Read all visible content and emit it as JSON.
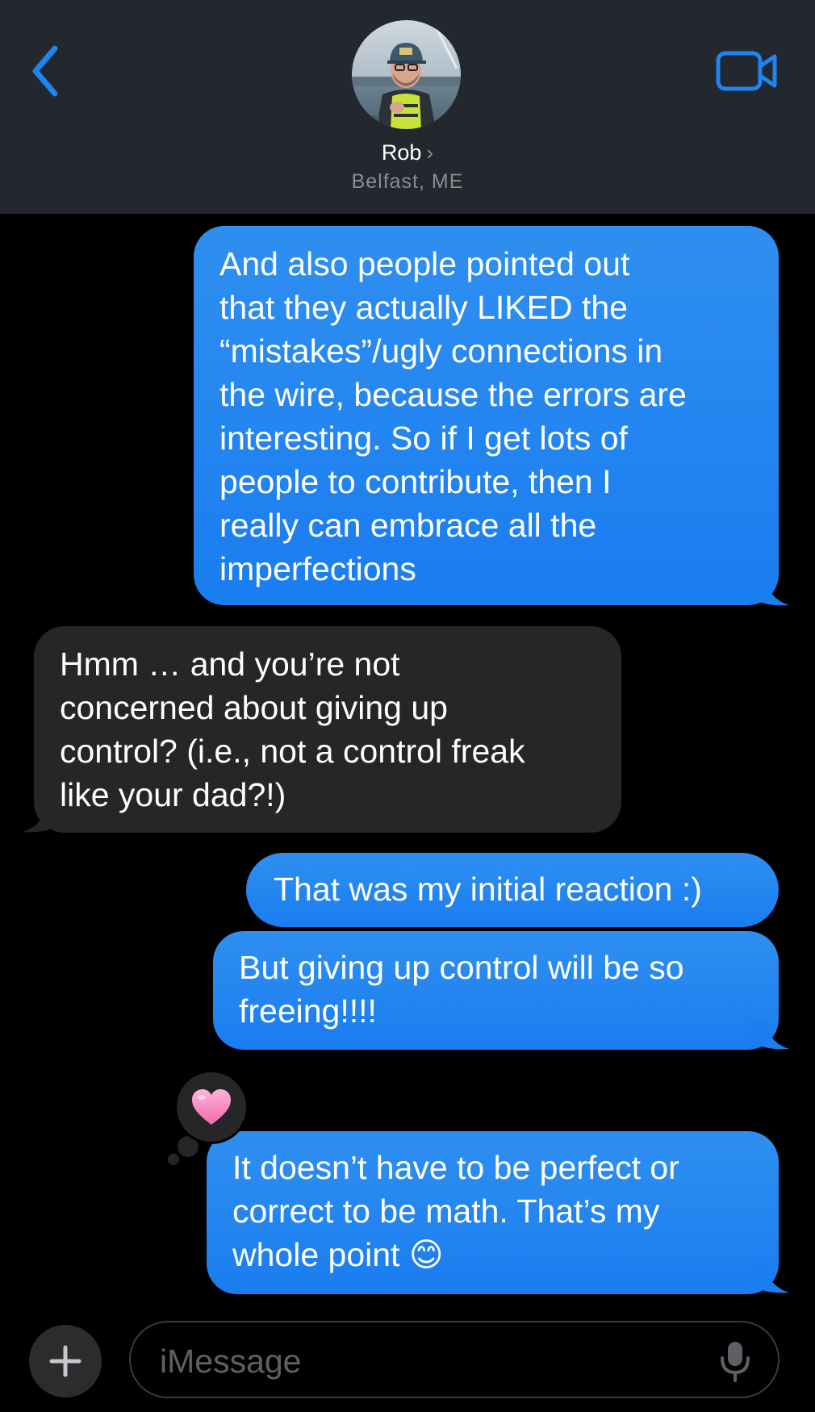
{
  "contact": {
    "name": "Rob",
    "location": "Belfast, ME"
  },
  "messages": [
    {
      "direction": "sent",
      "lines": [
        "And also people pointed out",
        "that they actually LIKED the",
        "“mistakes”/ugly connections in",
        "the wire, because the errors are",
        "interesting. So if I get lots of",
        "people to contribute, then I",
        "really can embrace all the",
        "imperfections"
      ]
    },
    {
      "direction": "received",
      "lines": [
        "Hmm … and you’re not",
        "concerned about giving up",
        "control?  (i.e., not a control freak",
        "like your dad?!)"
      ]
    },
    {
      "direction": "sent",
      "lines": [
        "That was my initial reaction :)"
      ]
    },
    {
      "direction": "sent",
      "lines": [
        "But giving up control will be so",
        "freeing!!!!"
      ]
    },
    {
      "direction": "sent",
      "lines": [
        "It doesn’t have to be perfect or",
        "correct to be math. That’s my",
        "whole point 😊"
      ],
      "reaction": "heart-icon"
    }
  ],
  "composer": {
    "placeholder": "iMessage"
  },
  "colors": {
    "accent": "#1f84f2",
    "sent_bubble": "#1a7df0",
    "received_bubble": "#262628",
    "header_bg": "#23282e"
  }
}
